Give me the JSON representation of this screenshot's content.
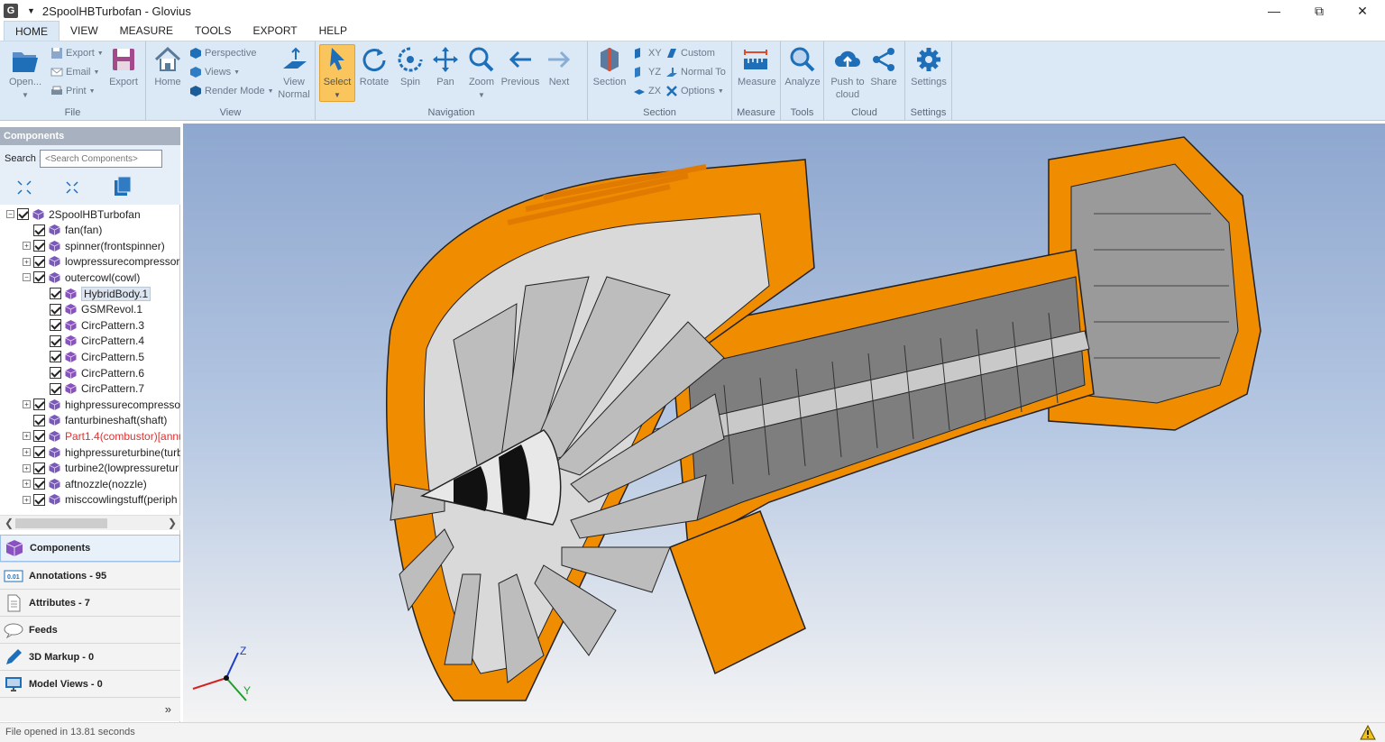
{
  "window": {
    "title": "2SpoolHBTurbofan - Glovius",
    "app_icon": "G"
  },
  "menu_tabs": [
    "HOME",
    "VIEW",
    "MEASURE",
    "TOOLS",
    "EXPORT",
    "HELP"
  ],
  "ribbon": {
    "file": {
      "open": "Open...",
      "export_small": "Export",
      "email": "Email",
      "print": "Print",
      "export_big": "Export",
      "label": "File"
    },
    "view": {
      "home": "Home",
      "perspective": "Perspective",
      "views": "Views",
      "render_mode": "Render Mode",
      "view_normal_1": "View",
      "view_normal_2": "Normal",
      "label": "View"
    },
    "navigation": {
      "select": "Select",
      "rotate": "Rotate",
      "spin": "Spin",
      "pan": "Pan",
      "zoom": "Zoom",
      "previous": "Previous",
      "next": "Next",
      "label": "Navigation"
    },
    "section": {
      "section": "Section",
      "xy": "XY",
      "yz": "YZ",
      "zx": "ZX",
      "custom": "Custom",
      "normal_to": "Normal To",
      "options": "Options",
      "label": "Section"
    },
    "measure": {
      "measure": "Measure",
      "label": "Measure"
    },
    "tools": {
      "analyze": "Analyze",
      "label": "Tools"
    },
    "cloud": {
      "push_1": "Push to",
      "push_2": "cloud",
      "share": "Share",
      "label": "Cloud"
    },
    "settings": {
      "settings": "Settings",
      "label": "Settings"
    }
  },
  "components_panel": {
    "header": "Components",
    "search_label": "Search :",
    "search_placeholder": "<Search Components>"
  },
  "tree": [
    {
      "label": "2SpoolHBTurbofan",
      "indent": 0,
      "expander": "-",
      "red": false,
      "selected": false
    },
    {
      "label": "fan(fan)",
      "indent": 1,
      "expander": "",
      "red": false,
      "selected": false
    },
    {
      "label": "spinner(frontspinner)",
      "indent": 1,
      "expander": "+",
      "red": false,
      "selected": false
    },
    {
      "label": "lowpressurecompressor",
      "indent": 1,
      "expander": "+",
      "red": false,
      "selected": false
    },
    {
      "label": "outercowl(cowl)",
      "indent": 1,
      "expander": "-",
      "red": false,
      "selected": false
    },
    {
      "label": "HybridBody.1",
      "indent": 2,
      "expander": "",
      "red": false,
      "selected": true
    },
    {
      "label": "GSMRevol.1",
      "indent": 2,
      "expander": "",
      "red": false,
      "selected": false
    },
    {
      "label": "CircPattern.3",
      "indent": 2,
      "expander": "",
      "red": false,
      "selected": false
    },
    {
      "label": "CircPattern.4",
      "indent": 2,
      "expander": "",
      "red": false,
      "selected": false
    },
    {
      "label": "CircPattern.5",
      "indent": 2,
      "expander": "",
      "red": false,
      "selected": false
    },
    {
      "label": "CircPattern.6",
      "indent": 2,
      "expander": "",
      "red": false,
      "selected": false
    },
    {
      "label": "CircPattern.7",
      "indent": 2,
      "expander": "",
      "red": false,
      "selected": false
    },
    {
      "label": "highpressurecompressor",
      "indent": 1,
      "expander": "+",
      "red": false,
      "selected": false
    },
    {
      "label": "fanturbineshaft(shaft)",
      "indent": 1,
      "expander": "",
      "red": false,
      "selected": false
    },
    {
      "label": "Part1.4(combustor)[annu",
      "indent": 1,
      "expander": "+",
      "red": true,
      "selected": false
    },
    {
      "label": "highpressureturbine(turb",
      "indent": 1,
      "expander": "+",
      "red": false,
      "selected": false
    },
    {
      "label": "turbine2(lowpressuretur",
      "indent": 1,
      "expander": "+",
      "red": false,
      "selected": false
    },
    {
      "label": "aftnozzle(nozzle)",
      "indent": 1,
      "expander": "+",
      "red": false,
      "selected": false
    },
    {
      "label": "misccowlingstuff(periph",
      "indent": 1,
      "expander": "+",
      "red": false,
      "selected": false
    }
  ],
  "panel_tabs": [
    {
      "label": "Components",
      "icon": "cube-icon"
    },
    {
      "label": "Annotations - 95",
      "icon": "annotation-icon"
    },
    {
      "label": "Attributes - 7",
      "icon": "document-icon"
    },
    {
      "label": "Feeds",
      "icon": "chat-icon"
    },
    {
      "label": "3D Markup - 0",
      "icon": "pen-icon"
    },
    {
      "label": "Model Views - 0",
      "icon": "monitor-icon"
    }
  ],
  "triad": {
    "z": "Z",
    "y": "Y"
  },
  "status": {
    "text": "File opened in 13.81 seconds"
  },
  "colors": {
    "ribbon_bg": "#dbe8f6",
    "select_active": "#f9c55c",
    "model_orange": "#f08c00",
    "icon_blue": "#1e6fb8"
  }
}
